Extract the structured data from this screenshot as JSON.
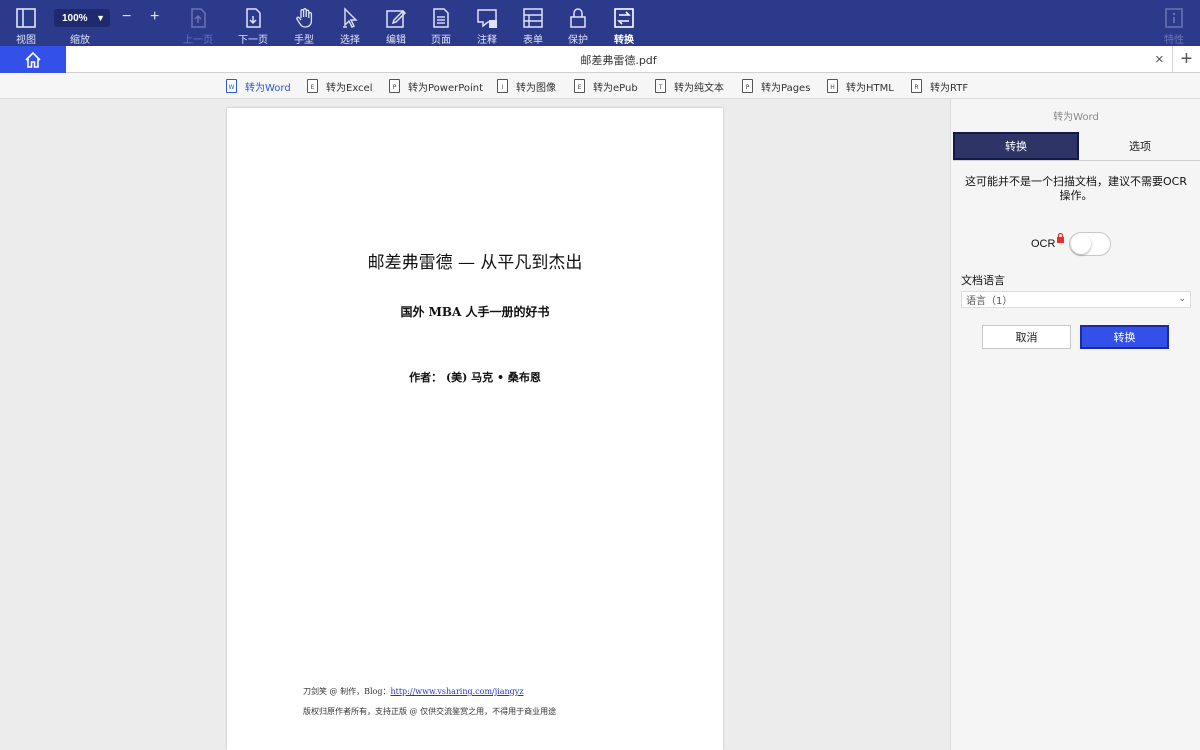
{
  "toolbar": {
    "items": [
      {
        "label": "视图",
        "icon": "sidebar-view-icon"
      },
      {
        "label": "上一页",
        "icon": "page-up-icon"
      },
      {
        "label": "下一页",
        "icon": "page-down-icon"
      },
      {
        "label": "手型",
        "icon": "hand-icon"
      },
      {
        "label": "选择",
        "icon": "cursor-icon"
      },
      {
        "label": "编辑",
        "icon": "edit-icon"
      },
      {
        "label": "页面",
        "icon": "page-icon"
      },
      {
        "label": "注释",
        "icon": "comment-icon"
      },
      {
        "label": "表单",
        "icon": "form-icon"
      },
      {
        "label": "保护",
        "icon": "lock-icon"
      },
      {
        "label": "转换",
        "icon": "convert-icon"
      },
      {
        "label": "特性",
        "icon": "info-icon"
      }
    ],
    "zoom_value": "100%",
    "zoom_label": "缩放",
    "zoom_minus": "−",
    "zoom_plus": "+"
  },
  "tabs": {
    "file_name": "邮差弗雷德.pdf",
    "close": "×",
    "add": "+"
  },
  "convert_bar": {
    "items": [
      {
        "label": "转为Word",
        "letter": "W"
      },
      {
        "label": "转为Excel",
        "letter": "E"
      },
      {
        "label": "转为PowerPoint",
        "letter": "P"
      },
      {
        "label": "转为图像",
        "letter": "I"
      },
      {
        "label": "转为ePub",
        "letter": "E"
      },
      {
        "label": "转为纯文本",
        "letter": "T"
      },
      {
        "label": "转为Pages",
        "letter": "P"
      },
      {
        "label": "转为HTML",
        "letter": "H"
      },
      {
        "label": "转为RTF",
        "letter": "R"
      }
    ]
  },
  "document": {
    "title": "邮差弗雷德 — 从平凡到杰出",
    "subtitle": "国外 MBA 人手一册的好书",
    "author": "作者： (美) 马克 • 桑布恩",
    "footer_prefix": "刀剑笑 @ 制作，Blog：",
    "footer_link": "http://www.vsharing.com/jiangyz",
    "footer_line2": "版权归原作者所有，支持正版 @ 仅供交流鉴赏之用，不得用于商业用途"
  },
  "panel": {
    "header": "转为Word",
    "tab_convert": "转换",
    "tab_options": "选项",
    "ocr_note": "这可能并不是一个扫描文档，建议不需要OCR操作。",
    "ocr_label": "OCR",
    "ocr_enabled": false,
    "lang_label": "文档语言",
    "lang_value": "语言（1）",
    "cancel_label": "取消",
    "convert_label": "转换",
    "accent_color": "#3350e8"
  }
}
